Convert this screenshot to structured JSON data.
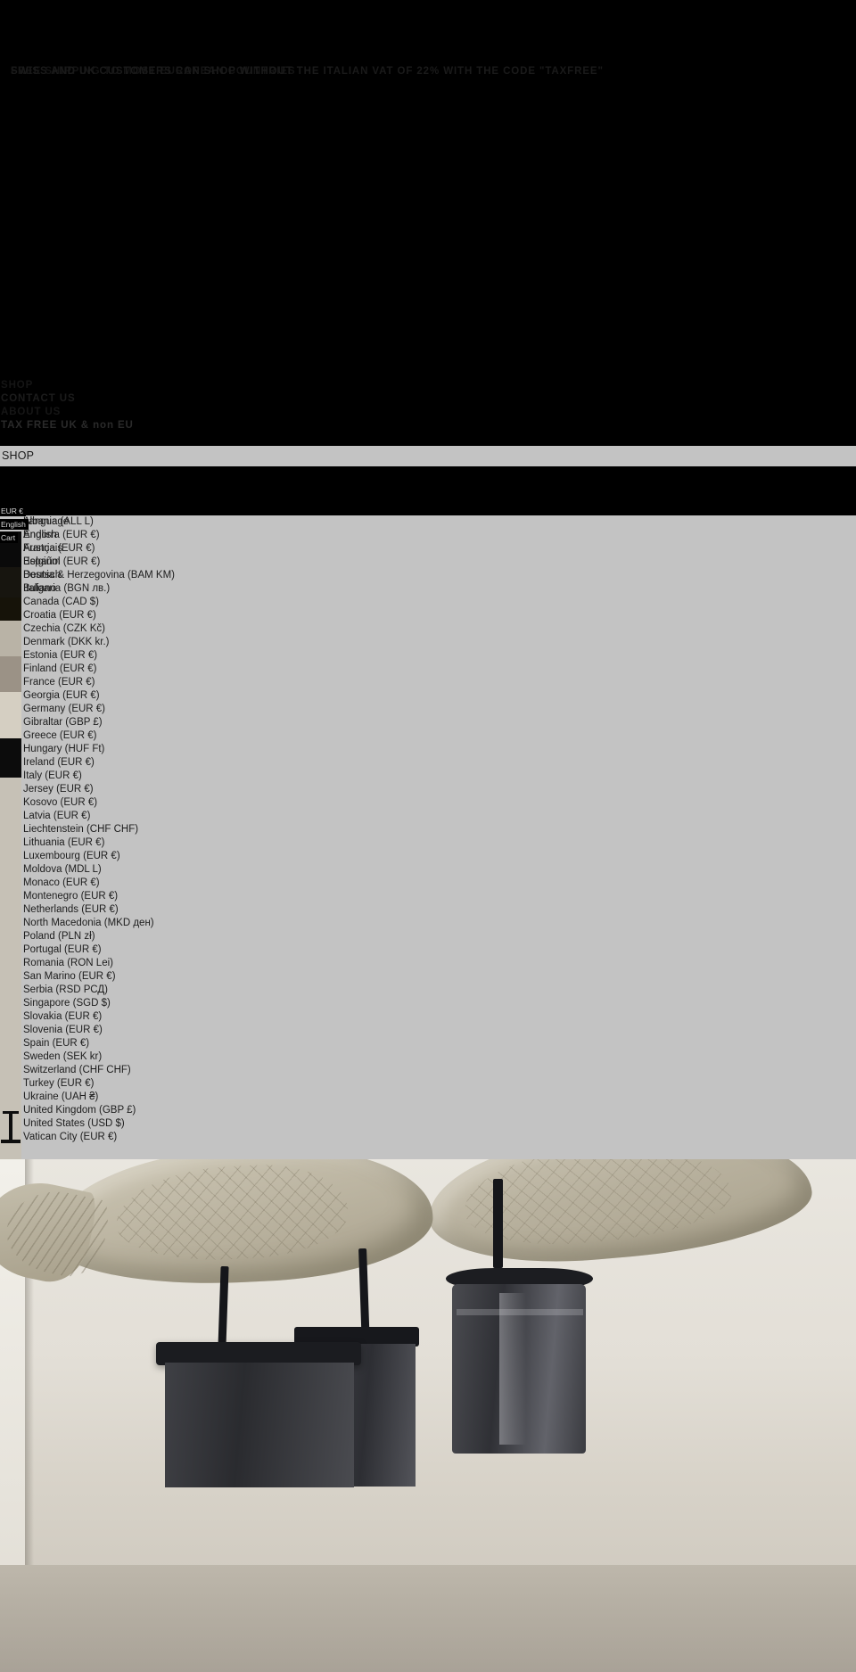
{
  "announcement": {
    "line_1": "FREE SHIPPING TO MOST EUROPEAN COUNTRIES",
    "line_2": "SWISS AND UK CUSTOMERS CAN SHOP WITHOUT THE ITALIAN VAT OF 22% WITH THE CODE \"TAXFREE\""
  },
  "nav": {
    "items": [
      {
        "label": "SHOP"
      },
      {
        "label": "CONTACT US"
      },
      {
        "label": "ABOUT US"
      },
      {
        "label": "TAX FREE UK & non EU"
      }
    ]
  },
  "shop_strip": {
    "label": "SHOP"
  },
  "selectors": {
    "currency": "EUR €",
    "language": "English",
    "cart": "Cart"
  },
  "language_panel": {
    "heading": "Language",
    "options": [
      "English",
      "Français",
      "Español",
      "Deutsch",
      "Italiano"
    ]
  },
  "country_panel": {
    "options": [
      "Albania (ALL L)",
      "Andorra (EUR €)",
      "Austria (EUR €)",
      "Belgium (EUR €)",
      "Bosnia & Herzegovina (BAM KM)",
      "Bulgaria (BGN лв.)",
      "Canada (CAD $)",
      "Croatia (EUR €)",
      "Czechia (CZK Kč)",
      "Denmark (DKK kr.)",
      "Estonia (EUR €)",
      "Finland (EUR €)",
      "France (EUR €)",
      "Georgia (EUR €)",
      "Germany (EUR €)",
      "Gibraltar (GBP £)",
      "Greece (EUR €)",
      "Hungary (HUF Ft)",
      "Ireland (EUR €)",
      "Italy (EUR €)",
      "Jersey (EUR €)",
      "Kosovo (EUR €)",
      "Latvia (EUR €)",
      "Liechtenstein (CHF CHF)",
      "Lithuania (EUR €)",
      "Luxembourg (EUR €)",
      "Moldova (MDL L)",
      "Monaco (EUR €)",
      "Montenegro (EUR €)",
      "Netherlands (EUR €)",
      "North Macedonia (MKD ден)",
      "Poland (PLN zł)",
      "Portugal (EUR €)",
      "Romania (RON Lei)",
      "San Marino (EUR €)",
      "Serbia (RSD РСД)",
      "Singapore (SGD $)",
      "Slovakia (EUR €)",
      "Slovenia (EUR €)",
      "Spain (EUR €)",
      "Sweden (SEK kr)",
      "Switzerland (CHF CHF)",
      "Turkey (EUR €)",
      "Ukraine (UAH ₴)",
      "United Kingdom (GBP £)",
      "United States (USD $)",
      "Vatican City (EUR €)"
    ]
  },
  "hero": {
    "alt": "Two carved stone fish sculptures mounted on dark stone plinths"
  },
  "colors": {
    "background": "#000000",
    "panel": "#c3c3c3",
    "text_dark": "#1d1d1d",
    "strip": "#c3c3c3"
  }
}
